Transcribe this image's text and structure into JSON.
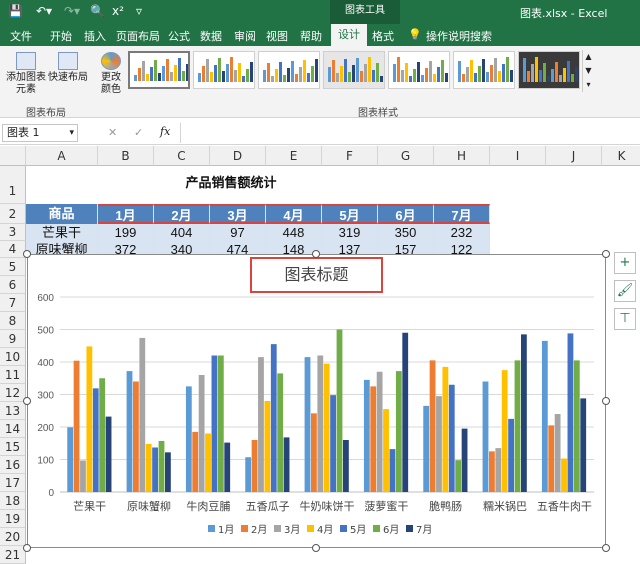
{
  "window": {
    "context_tab": "图表工具",
    "title": "图表.xlsx - Excel"
  },
  "tabs": [
    "文件",
    "开始",
    "插入",
    "页面布局",
    "公式",
    "数据",
    "审阅",
    "视图",
    "帮助",
    "设计",
    "格式"
  ],
  "tell_me": "操作说明搜索",
  "ribbon": {
    "add_element_1": "添加图表",
    "add_element_2": "元素",
    "quick_layout": "快速布局",
    "change_colors_1": "更改",
    "change_colors_2": "颜色",
    "group_layout": "图表布局",
    "group_styles": "图表样式"
  },
  "formula_bar": {
    "name_box": "图表 1",
    "fx": "fx",
    "cancel": "✕",
    "confirm": "✓"
  },
  "columns": [
    "A",
    "B",
    "C",
    "D",
    "E",
    "F",
    "G",
    "H",
    "I",
    "J",
    "K"
  ],
  "rows": [
    "1",
    "2",
    "3",
    "4",
    "5",
    "6",
    "7",
    "8",
    "9",
    "10",
    "11",
    "12",
    "13",
    "14",
    "15",
    "16",
    "17",
    "18",
    "19",
    "20",
    "21",
    "22"
  ],
  "sheet": {
    "title": "产品销售额统计",
    "header": [
      "商品",
      "1月",
      "2月",
      "3月",
      "4月",
      "5月",
      "6月",
      "7月"
    ],
    "row3": [
      "芒果干",
      "199",
      "404",
      "97",
      "448",
      "319",
      "350",
      "232"
    ],
    "row4": [
      "原味蟹柳",
      "372",
      "340",
      "474",
      "148",
      "137",
      "157",
      "122"
    ]
  },
  "chart_data": {
    "type": "bar",
    "title": "图表标题",
    "categories": [
      "芒果干",
      "原味蟹柳",
      "牛肉豆脯",
      "五香瓜子",
      "牛奶味饼干",
      "菠萝蜜干",
      "脆鸭肠",
      "糯米锅巴",
      "五香牛肉干"
    ],
    "ylim": [
      0,
      600
    ],
    "yticks": [
      0,
      100,
      200,
      300,
      400,
      500,
      600
    ],
    "grid": true,
    "legend_position": "bottom",
    "colors": [
      "#5b9bd5",
      "#ed7d31",
      "#a5a5a5",
      "#ffc000",
      "#4472c4",
      "#70ad47",
      "#264478"
    ],
    "series": [
      {
        "name": "1月",
        "values": [
          199,
          372,
          325,
          107,
          415,
          345,
          265,
          340,
          465
        ]
      },
      {
        "name": "2月",
        "values": [
          404,
          340,
          185,
          160,
          242,
          325,
          405,
          125,
          205
        ]
      },
      {
        "name": "3月",
        "values": [
          97,
          474,
          360,
          415,
          420,
          370,
          295,
          135,
          240
        ]
      },
      {
        "name": "4月",
        "values": [
          448,
          148,
          180,
          280,
          395,
          255,
          385,
          375,
          103
        ]
      },
      {
        "name": "5月",
        "values": [
          319,
          137,
          420,
          455,
          298,
          132,
          330,
          225,
          488
        ]
      },
      {
        "name": "6月",
        "values": [
          350,
          157,
          420,
          365,
          500,
          372,
          98,
          405,
          405
        ]
      },
      {
        "name": "7月",
        "values": [
          232,
          122,
          152,
          168,
          160,
          490,
          195,
          485,
          288
        ]
      }
    ]
  },
  "side_buttons": [
    "+",
    "🖌",
    "⊤"
  ]
}
